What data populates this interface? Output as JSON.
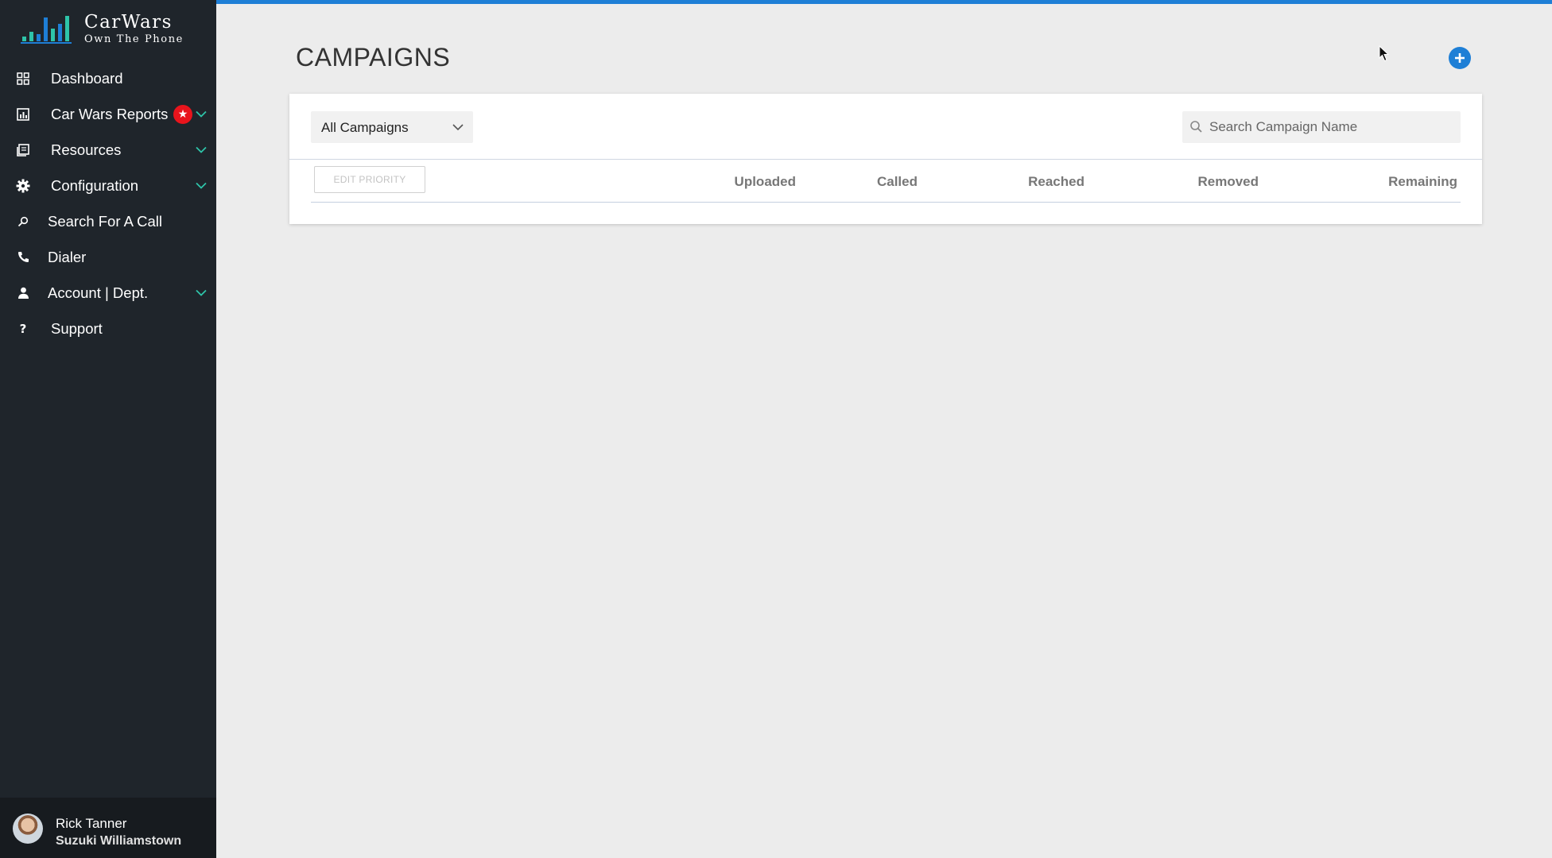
{
  "brand": {
    "title": "CarWars",
    "tagline": "Own The Phone",
    "accent_color": "#1e7fd6",
    "logo_bar_colors": [
      "#2ec4a9",
      "#1e7fd6"
    ]
  },
  "sidebar": {
    "background": "#1f252b",
    "items": [
      {
        "label": "Dashboard",
        "icon": "grid-icon",
        "has_chevron": false
      },
      {
        "label": "Car Wars Reports",
        "icon": "bar-chart-icon",
        "has_chevron": true,
        "badge": "★"
      },
      {
        "label": "Resources",
        "icon": "book-icon",
        "has_chevron": true
      },
      {
        "label": "Configuration",
        "icon": "gear-icon",
        "has_chevron": true
      },
      {
        "label": "Search For A Call",
        "icon": "search-icon",
        "has_chevron": false
      },
      {
        "label": "Dialer",
        "icon": "phone-icon",
        "has_chevron": false
      },
      {
        "label": "Account | Dept.",
        "icon": "user-icon",
        "has_chevron": true
      },
      {
        "label": "Support",
        "icon": "question-icon",
        "has_chevron": false
      }
    ],
    "user": {
      "name": "Rick Tanner",
      "dept": "Suzuki Williamstown"
    }
  },
  "main": {
    "title": "CAMPAIGNS",
    "filter": {
      "selected": "All Campaigns"
    },
    "search": {
      "placeholder": "Search Campaign Name",
      "value": ""
    },
    "table": {
      "edit_priority_label": "EDIT PRIORITY",
      "columns": [
        "Uploaded",
        "Called",
        "Reached",
        "Removed",
        "Remaining"
      ],
      "rows": []
    }
  }
}
